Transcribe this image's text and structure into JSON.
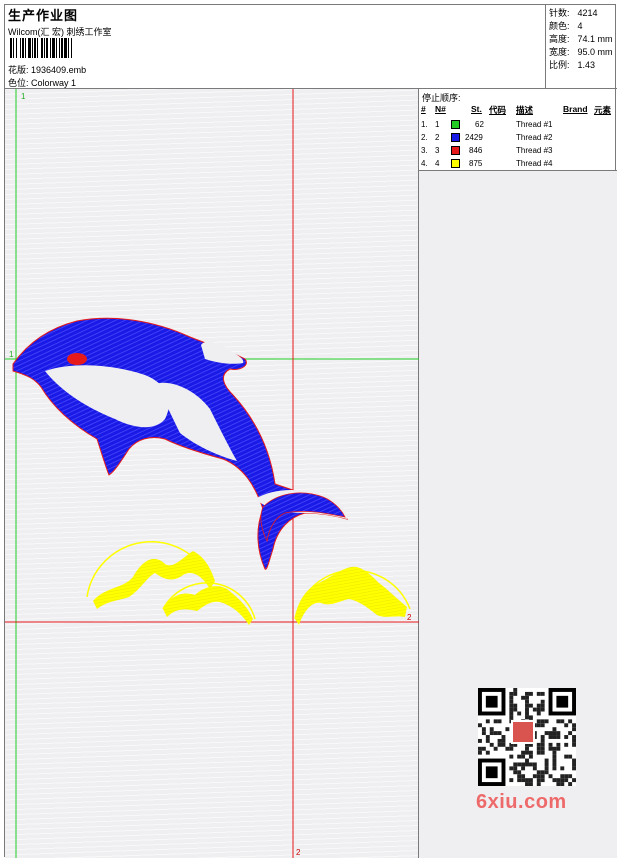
{
  "header": {
    "title": "生产作业图",
    "studio": "Wilcom(汇 宏) 刺绣工作室",
    "file_label": "花版:",
    "file_name": "1936409.emb",
    "colorway_label": "色位:",
    "colorway": "Colorway 1"
  },
  "stats": [
    {
      "label": "针数:",
      "value": "4214"
    },
    {
      "label": "颜色:",
      "value": "4"
    },
    {
      "label": "高度:",
      "value": "74.1 mm"
    },
    {
      "label": "宽度:",
      "value": "95.0 mm"
    },
    {
      "label": "比例:",
      "value": "1.43"
    }
  ],
  "stops": {
    "title": "停止顺序:",
    "headers": {
      "num": "#",
      "n": "N#",
      "st": "St.",
      "code": "代码",
      "desc": "描述",
      "brand": "Brand",
      "element": "元素"
    },
    "rows": [
      {
        "num": "1.",
        "n": "1",
        "st": "62",
        "color": "#22cc22",
        "desc": "Thread #1"
      },
      {
        "num": "2.",
        "n": "2",
        "st": "2429",
        "color": "#1a1ae6",
        "desc": "Thread #2"
      },
      {
        "num": "3.",
        "n": "3",
        "st": "846",
        "color": "#e61a1a",
        "desc": "Thread #3"
      },
      {
        "num": "4.",
        "n": "4",
        "st": "875",
        "color": "#ffff00",
        "desc": "Thread #4"
      }
    ]
  },
  "guides": {
    "vertical_label": "1",
    "horizontal_label": "1",
    "red_v_label": "2",
    "red_h_label": "2"
  },
  "colors": {
    "blue": "#1a1ae6",
    "red": "#e61a1a",
    "yellow": "#ffff00",
    "green": "#22cc22",
    "background": "#efeff2"
  },
  "watermark": {
    "text": "6xiu.com"
  }
}
